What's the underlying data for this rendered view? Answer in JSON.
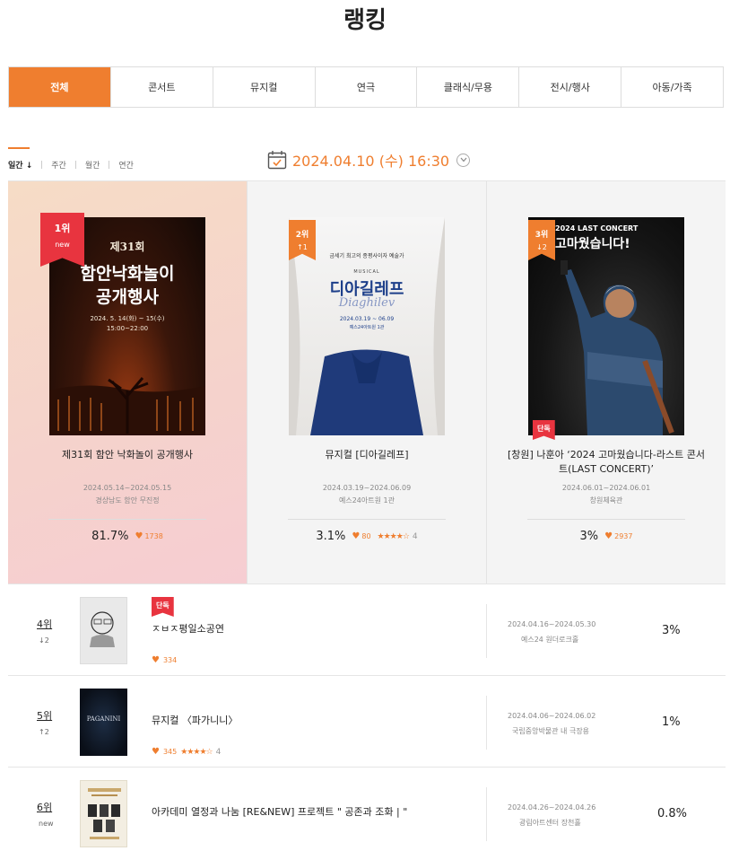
{
  "page": {
    "title": "랭킹"
  },
  "tabs": [
    "전체",
    "콘서트",
    "뮤지컬",
    "연극",
    "클래식/무용",
    "전시/행사",
    "아동/가족"
  ],
  "period": {
    "items": [
      "일간 ↓",
      "주간",
      "월간",
      "연간"
    ]
  },
  "datebar": {
    "value": "2024.04.10 (수) 16:30"
  },
  "top3": [
    {
      "rank": "1위",
      "change": "new",
      "poster_top": "제31회",
      "poster_main_1": "함안낙화놀이",
      "poster_main_2": "공개행사",
      "poster_date": "2024. 5. 14(화) ~ 15(수)",
      "poster_time": "15:00~22:00",
      "title": "제31회 함안 낙화놀이 공개행사",
      "dates": "2024.05.14~2024.05.15",
      "venue": "경상남도 함안 무진정",
      "percent": "81.7%",
      "likes": "1738"
    },
    {
      "rank": "2위",
      "change": "↑1",
      "poster_sub": "금세기 최고의 종평사이자 예술가",
      "poster_tag": "MUSICAL",
      "poster_main": "디아길레프",
      "poster_script": "Diaghilev",
      "poster_date": "2024.03.19 ~ 06.09",
      "poster_venue": "예스24아트원 1관",
      "title": "뮤지컬 [디아길레프]",
      "dates": "2024.03.19~2024.06.09",
      "venue": "예스24아트원 1관",
      "percent": "3.1%",
      "likes": "80",
      "stars": "★★★★☆",
      "rating": "4"
    },
    {
      "rank": "3위",
      "change": "↓2",
      "badge": "단독",
      "poster_head": "2024 LAST CONCERT",
      "poster_main": "고마웠습니다!",
      "title": "[창원] 나훈아 ‘2024 고마웠습니다-라스트 콘서트(LAST CONCERT)’",
      "dates": "2024.06.01~2024.06.01",
      "venue": "창원체육관",
      "percent": "3%",
      "likes": "2937"
    }
  ],
  "rows": [
    {
      "rank": "4위",
      "change": "↓2",
      "badge": "단독",
      "title": "ㅈㅂㅈ평일소공연",
      "likes": "334",
      "dates": "2024.04.16~2024.05.30",
      "venue": "예스24 원더로크홀",
      "percent": "3%"
    },
    {
      "rank": "5위",
      "change": "↑2",
      "poster_text": "PAGANINI",
      "title": "뮤지컬 〈파가니니〉",
      "likes": "345",
      "stars": "★★★★☆",
      "rating": "4",
      "dates": "2024.04.06~2024.06.02",
      "venue": "국립중앙박물관 내 극장용",
      "percent": "1%"
    },
    {
      "rank": "6위",
      "change": "new",
      "title": "아카데미 열정과 나눔 [RE&NEW] 프로젝트 \" 공존과 조화 | \"",
      "dates": "2024.04.26~2024.04.26",
      "venue": "광림아트센터 장천홀",
      "percent": "0.8%"
    }
  ]
}
